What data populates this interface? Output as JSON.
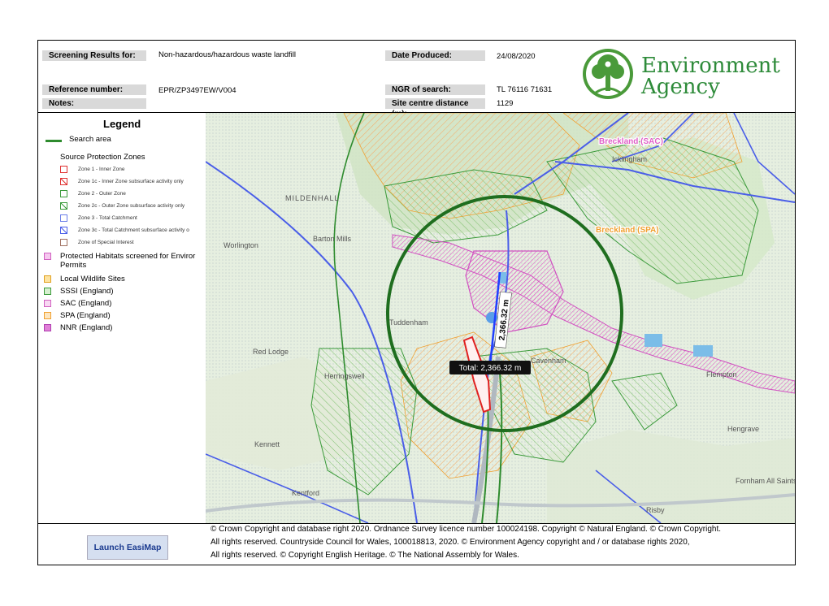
{
  "header": {
    "screening_label": "Screening Results for:",
    "screening_value": "Non-hazardous/hazardous waste landfill",
    "date_label": "Date Produced:",
    "date_value": "24/08/2020",
    "reference_label": "Reference number:",
    "reference_value": "EPR/ZP3497EW/V004",
    "ngr_label": "NGR of search:",
    "ngr_value": "TL 76116 71631",
    "notes_label": "Notes:",
    "distance_label": "Site centre distance (m):",
    "distance_value": "1129"
  },
  "logo": {
    "line1": "Environment",
    "line2": "Agency",
    "color": "#2e8b3a"
  },
  "legend": {
    "title": "Legend",
    "search_area": "Search area",
    "spz_heading": "Source Protection Zones",
    "spz_items": [
      "Zone 1 - Inner Zone",
      "Zone 1c - Inner Zone subsurface activity only",
      "Zone 2 - Outer Zone",
      "Zone 2c - Outer Zone subsurface activity only",
      "Zone 3 - Total Catchment",
      "Zone 3c - Total Catchment subsurface activity o",
      "Zone of Special Interest"
    ],
    "habitats_line1": "Protected Habitats screened for Enviror",
    "habitats_line2": "Permits",
    "habitat_items": [
      "Local Wildlife Sites",
      "SSSI (England)",
      "SAC (England)",
      "SPA (England)",
      "NNR (England)"
    ]
  },
  "map": {
    "place_labels": [
      "MILDENHALL",
      "Barton Mills",
      "Worlington",
      "Tuddenham",
      "Red Lodge",
      "Herringswell",
      "Kennett",
      "Kentford",
      "Risby",
      "Flempton",
      "Hengrave",
      "Fornham All Saints",
      "Cavenham",
      "Icklingham"
    ],
    "designation_labels": [
      "Breckland (SAC)",
      "Breckland (SPA)"
    ],
    "measure_vertical": "2,366.32 m",
    "measure_total": "Total: 2,366.32 m",
    "colors": {
      "search_area": "#1f6e1f",
      "spz3": "#4a5ee8",
      "sac": "#e060c8",
      "spa": "#f0a030",
      "sssi": "#3a9a3a"
    }
  },
  "footer": {
    "launch_label": "Launch EasiMap",
    "copyright_line1": "© Crown Copyright and database right 2020. Ordnance Survey licence number 100024198. Copyright © Natural England. © Crown Copyright.",
    "copyright_line2": "All rights reserved.  Countryside Council for Wales, 100018813, 2020. © Environment Agency copyright and / or database rights 2020,",
    "copyright_line3": "All rights reserved.  © Copyright English Heritage.  © The National Assembly for Wales."
  }
}
